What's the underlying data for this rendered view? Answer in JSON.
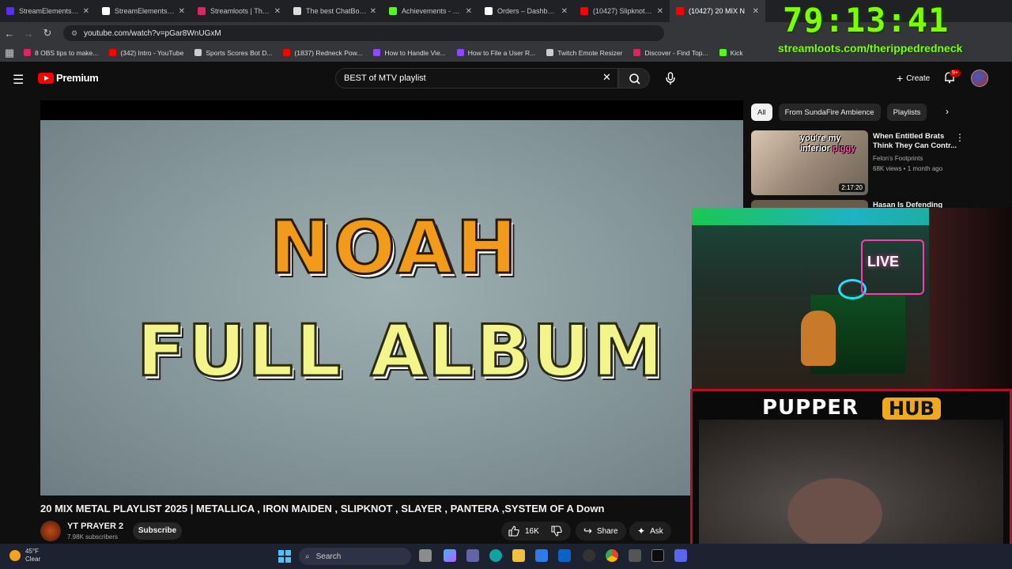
{
  "tabs": [
    {
      "label": "StreamElements - Ov",
      "color": "#5b2df0",
      "active": false
    },
    {
      "label": "StreamElements - rip",
      "color": "#ffffff",
      "active": false
    },
    {
      "label": "Streamloots | Theripp",
      "color": "#e0245e",
      "active": false
    },
    {
      "label": "The best ChatBot and",
      "color": "#dddddd",
      "active": false
    },
    {
      "label": "Achievements - Kick",
      "color": "#53fc18",
      "active": false
    },
    {
      "label": "Orders – Dashboard",
      "color": "#ffffff",
      "active": false
    },
    {
      "label": "(10427) Slipknot - Du",
      "color": "#ff0000",
      "active": false
    },
    {
      "label": "(10427) 20 MIX N",
      "color": "#ff0000",
      "active": true
    }
  ],
  "address": {
    "url": "youtube.com/watch?v=pGar8WnUGxM"
  },
  "bookmarks": [
    {
      "label": "8 OBS tips to make...",
      "color": "#e0245e"
    },
    {
      "label": "(342) Intro - YouTube",
      "color": "#ff0000"
    },
    {
      "label": "Sports Scores Bot D...",
      "color": "#cccccc"
    },
    {
      "label": "(1837) Redneck Pow...",
      "color": "#ff0000"
    },
    {
      "label": "How to Handle Vie...",
      "color": "#9146ff"
    },
    {
      "label": "How to File a User R...",
      "color": "#9146ff"
    },
    {
      "label": "Twitch Emote Resizer",
      "color": "#cccccc"
    },
    {
      "label": "Discover - Find Top...",
      "color": "#e0245e"
    },
    {
      "label": "Kick",
      "color": "#53fc18"
    }
  ],
  "overlay": {
    "timer": "79:13:41",
    "url": "streamloots.com/therippedredneck",
    "brand_left": "PUPPER",
    "brand_right": "HUB",
    "sign_text": "LIVE"
  },
  "youtube": {
    "brand": "Premium",
    "search_query": "BEST of MTV playlist",
    "create_label": "Create",
    "notifications": "9+"
  },
  "video": {
    "thumb_line1": "NOAH",
    "thumb_line2": "FULL ALBUM",
    "title": "20 MIX METAL PLAYLIST 2025 | METALLICA , IRON MAIDEN , SLIPKNOT , SLAYER , PANTERA ,SYSTEM OF A Down",
    "channel": "YT PRAYER 2",
    "subscribers": "7.98K subscribers",
    "subscribe_label": "Subscribe",
    "likes": "16K",
    "share_label": "Share",
    "ask_label": "Ask"
  },
  "sidebar": {
    "chips": [
      "All",
      "From SundaFire Ambience",
      "Playlists"
    ],
    "recommendations": [
      {
        "title": "When Entitled Brats Think They Can Contr...",
        "channel": "Felon's Footprints",
        "meta": "68K views • 1 month ago",
        "duration": "2:17:20",
        "thumb_text_a": "you're my",
        "thumb_text_b": "inferior",
        "thumb_text_c": "piggy"
      },
      {
        "title": "Hasan Is Defending"
      }
    ]
  },
  "taskbar": {
    "temp": "45°F",
    "condition": "Clear",
    "search_placeholder": "Search"
  }
}
